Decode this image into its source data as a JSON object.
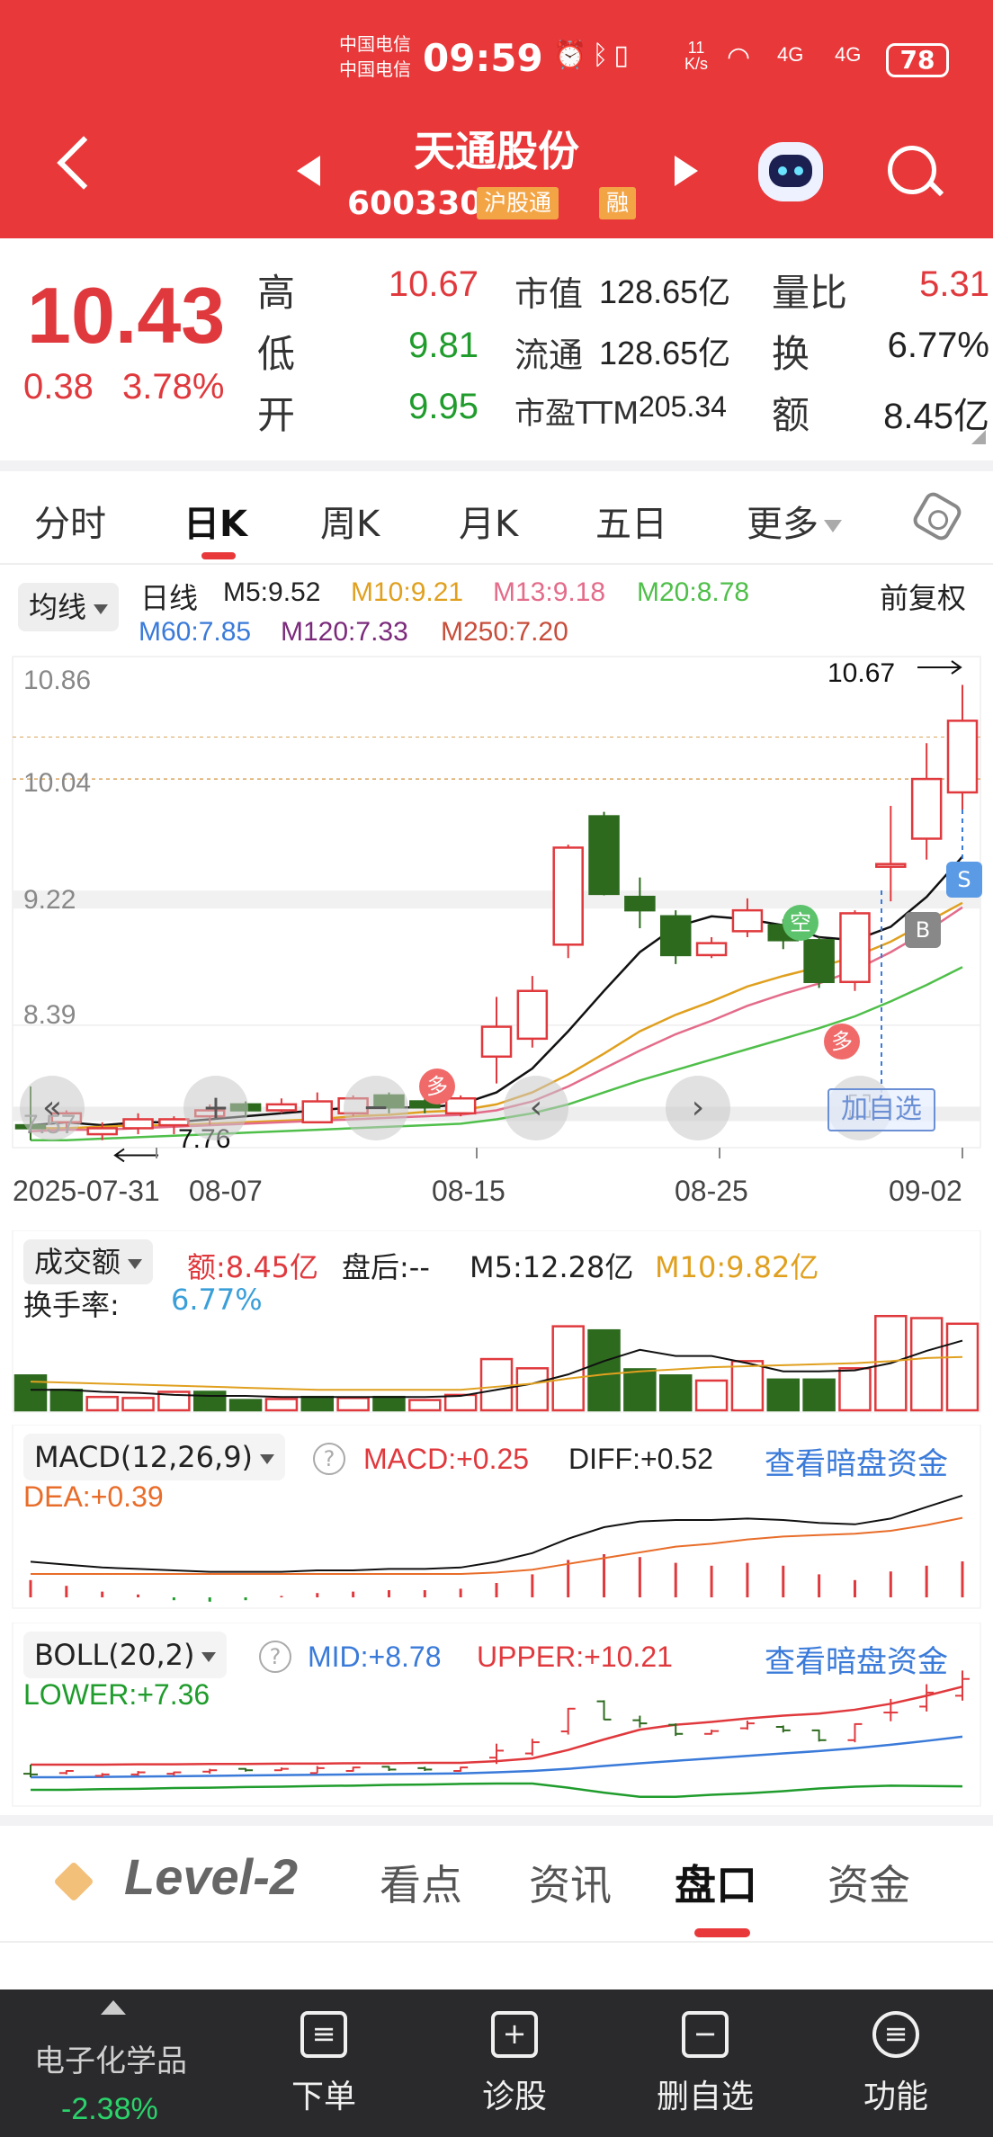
{
  "status_bar": {
    "carrier_1": "中国电信",
    "carrier_2": "中国电信",
    "time": "09:59",
    "net_speed": "11 K/s",
    "network": "4G",
    "battery": "78"
  },
  "header": {
    "stock_name": "天通股份",
    "stock_code": "600330",
    "tag_connect": "沪股通",
    "tag_margin": "融",
    "icons": [
      "back-icon",
      "prev-stock-icon",
      "next-stock-icon",
      "robot-assistant-icon",
      "search-icon"
    ]
  },
  "quote": {
    "price": "10.43",
    "change": "0.38",
    "change_pct": "3.78%",
    "high_label": "高",
    "high": "10.67",
    "low_label": "低",
    "low": "9.81",
    "open_label": "开",
    "open": "9.95",
    "mktcap_label": "市值",
    "mktcap": "128.65亿",
    "float_label": "流通",
    "float": "128.65亿",
    "pe_label": "市盈TTM",
    "pe": "205.34",
    "volratio_label": "量比",
    "volratio": "5.31",
    "turnover_label": "换",
    "turnover": "6.77%",
    "amount_label": "额",
    "amount": "8.45亿"
  },
  "tabs": [
    "分时",
    "日K",
    "周K",
    "月K",
    "五日",
    "更多"
  ],
  "active_tab": "日K",
  "kline_legend": {
    "selector": "均线",
    "period": "日线",
    "adjust": "前复权",
    "ma": [
      {
        "text": "M5:9.52",
        "color": "#222222"
      },
      {
        "text": "M10:9.21",
        "color": "#e0a01f"
      },
      {
        "text": "M13:9.18",
        "color": "#e36c8a"
      },
      {
        "text": "M20:8.78",
        "color": "#4fbf4a"
      },
      {
        "text": "M60:7.85",
        "color": "#3a7ad9"
      },
      {
        "text": "M120:7.33",
        "color": "#7b2a7b"
      },
      {
        "text": "M250:7.20",
        "color": "#c84d3a"
      }
    ]
  },
  "colors": {
    "up": "#e0393d",
    "down": "#2d6a1e",
    "header_bg": "#e8383a",
    "link": "#3a7ad9"
  },
  "kline_axis": {
    "y_ticks": [
      "10.86",
      "10.04",
      "9.22",
      "8.39",
      "7.57"
    ],
    "high_marker": "10.67",
    "low_marker": "7.76",
    "dates": [
      "2025-07-31",
      "08-07",
      "08-15",
      "08-25",
      "09-02"
    ],
    "signals": {
      "sell": "S",
      "buy": "B",
      "short": "空",
      "long": "多",
      "long2": "多"
    },
    "add_favorite": "加自选"
  },
  "volume_panel": {
    "selector": "成交额",
    "amount": "额:8.45亿",
    "after_hours": "盘后:-- ",
    "m5": "M5:12.28亿",
    "m10": "M10:9.82亿",
    "turnover_label": "换手率:",
    "turnover": "6.77%"
  },
  "macd_panel": {
    "selector": "MACD(12,26,9)",
    "macd": "MACD:+0.25",
    "diff": "DIFF:+0.52",
    "dea": "DEA:+0.39",
    "link": "查看暗盘资金"
  },
  "boll_panel": {
    "selector": "BOLL(20,2)",
    "mid": "MID:+8.78",
    "upper": "UPPER:+10.21",
    "lower": "LOWER:+7.36",
    "link": "查看暗盘资金"
  },
  "bottom_tabs": [
    "Level-2",
    "看点",
    "资讯",
    "盘口",
    "资金"
  ],
  "active_bottom_tab": "盘口",
  "bottom_bar": {
    "sector_name": "电子化学品",
    "sector_change": "-2.38%",
    "actions": [
      {
        "label": "下单",
        "icon": "order-icon"
      },
      {
        "label": "诊股",
        "icon": "diagnose-icon"
      },
      {
        "label": "删自选",
        "icon": "remove-favorite-icon"
      },
      {
        "label": "功能",
        "icon": "menu-icon"
      }
    ]
  },
  "chart_data": {
    "type": "candlestick",
    "title": "",
    "x_range": [
      "2025-07-31",
      "2025-09-02"
    ],
    "x_ticks": [
      "2025-07-31",
      "08-07",
      "08-15",
      "08-25",
      "09-02"
    ],
    "ylim": [
      7.57,
      10.86
    ],
    "y_ticks": [
      10.86,
      10.04,
      9.22,
      8.39,
      7.57
    ],
    "candles": [
      {
        "o": 7.72,
        "c": 7.7,
        "h": 7.98,
        "l": 7.62
      },
      {
        "o": 7.74,
        "c": 7.8,
        "h": 7.82,
        "l": 7.7
      },
      {
        "o": 7.66,
        "c": 7.7,
        "h": 7.74,
        "l": 7.62
      },
      {
        "o": 7.7,
        "c": 7.76,
        "h": 7.8,
        "l": 7.66
      },
      {
        "o": 7.72,
        "c": 7.76,
        "h": 7.78,
        "l": 7.66
      },
      {
        "o": 7.78,
        "c": 7.82,
        "h": 7.86,
        "l": 7.72
      },
      {
        "o": 7.86,
        "c": 7.82,
        "h": 7.88,
        "l": 7.78
      },
      {
        "o": 7.82,
        "c": 7.86,
        "h": 7.9,
        "l": 7.8
      },
      {
        "o": 7.74,
        "c": 7.88,
        "h": 7.94,
        "l": 7.74
      },
      {
        "o": 7.8,
        "c": 7.9,
        "h": 7.92,
        "l": 7.78
      },
      {
        "o": 7.92,
        "c": 7.84,
        "h": 7.94,
        "l": 7.8
      },
      {
        "o": 7.88,
        "c": 7.84,
        "h": 7.92,
        "l": 7.8
      },
      {
        "o": 7.8,
        "c": 7.9,
        "h": 7.92,
        "l": 7.78
      },
      {
        "o": 8.18,
        "c": 8.38,
        "h": 8.58,
        "l": 8.0
      },
      {
        "o": 8.3,
        "c": 8.62,
        "h": 8.72,
        "l": 8.24
      },
      {
        "o": 8.93,
        "c": 9.58,
        "h": 9.6,
        "l": 8.84
      },
      {
        "o": 9.79,
        "c": 9.27,
        "h": 9.82,
        "l": 9.26
      },
      {
        "o": 9.25,
        "c": 9.16,
        "h": 9.38,
        "l": 9.04
      },
      {
        "o": 9.12,
        "c": 8.86,
        "h": 9.16,
        "l": 8.8
      },
      {
        "o": 8.86,
        "c": 8.94,
        "h": 8.98,
        "l": 8.84
      },
      {
        "o": 9.02,
        "c": 9.16,
        "h": 9.24,
        "l": 8.98
      },
      {
        "o": 9.06,
        "c": 8.96,
        "h": 9.1,
        "l": 8.9
      },
      {
        "o": 8.96,
        "c": 8.68,
        "h": 8.98,
        "l": 8.64
      },
      {
        "o": 8.68,
        "c": 9.14,
        "h": 9.16,
        "l": 8.62
      },
      {
        "o": 9.47,
        "c": 9.47,
        "h": 9.86,
        "l": 9.22
      },
      {
        "o": 9.64,
        "c": 10.04,
        "h": 10.28,
        "l": 9.5
      },
      {
        "o": 9.95,
        "c": 10.43,
        "h": 10.67,
        "l": 9.81
      }
    ],
    "ma_lines": [
      {
        "name": "M5",
        "values": [
          7.72,
          7.74,
          7.72,
          7.74,
          7.74,
          7.76,
          7.78,
          7.8,
          7.82,
          7.84,
          7.84,
          7.84,
          7.86,
          7.94,
          8.1,
          8.35,
          8.62,
          8.88,
          9.05,
          9.12,
          9.1,
          9.06,
          8.98,
          8.96,
          9.05,
          9.25,
          9.52
        ]
      },
      {
        "name": "M10",
        "values": [
          7.7,
          7.7,
          7.71,
          7.72,
          7.72,
          7.73,
          7.74,
          7.75,
          7.76,
          7.78,
          7.79,
          7.81,
          7.82,
          7.86,
          7.94,
          8.06,
          8.2,
          8.35,
          8.46,
          8.55,
          8.65,
          8.72,
          8.78,
          8.85,
          8.95,
          9.08,
          9.21
        ]
      },
      {
        "name": "M13",
        "values": [
          7.68,
          7.69,
          7.69,
          7.7,
          7.71,
          7.72,
          7.73,
          7.74,
          7.75,
          7.76,
          7.77,
          7.78,
          7.79,
          7.82,
          7.88,
          7.98,
          8.1,
          8.22,
          8.33,
          8.42,
          8.52,
          8.6,
          8.67,
          8.76,
          8.88,
          9.02,
          9.18
        ]
      },
      {
        "name": "M20",
        "values": [
          7.62,
          7.62,
          7.63,
          7.64,
          7.65,
          7.66,
          7.67,
          7.68,
          7.69,
          7.7,
          7.71,
          7.72,
          7.73,
          7.76,
          7.8,
          7.86,
          7.94,
          8.02,
          8.09,
          8.16,
          8.23,
          8.3,
          8.37,
          8.45,
          8.55,
          8.66,
          8.78
        ]
      }
    ],
    "volume": {
      "values": [
        3.4,
        2.0,
        1.3,
        1.2,
        1.8,
        1.8,
        1.0,
        1.1,
        1.3,
        1.2,
        1.3,
        1.0,
        1.5,
        5.0,
        4.1,
        8.2,
        7.8,
        4.0,
        3.4,
        2.9,
        4.8,
        3.0,
        3.0,
        4.1,
        9.2,
        9.0,
        8.45
      ],
      "up": [
        false,
        false,
        true,
        true,
        true,
        false,
        false,
        true,
        false,
        true,
        false,
        true,
        true,
        true,
        true,
        true,
        false,
        false,
        false,
        true,
        true,
        false,
        false,
        true,
        true,
        true,
        true
      ],
      "m5": [
        2.0,
        2.0,
        1.8,
        1.7,
        1.5,
        1.4,
        1.4,
        1.3,
        1.3,
        1.3,
        1.3,
        1.3,
        1.4,
        2.0,
        2.6,
        3.5,
        4.8,
        5.9,
        5.3,
        5.3,
        4.6,
        3.8,
        3.8,
        3.9,
        4.6,
        5.8,
        6.8
      ],
      "m10": [
        2.8,
        2.7,
        2.6,
        2.5,
        2.4,
        2.3,
        2.2,
        2.1,
        2.0,
        2.0,
        2.0,
        2.0,
        2.0,
        2.3,
        2.6,
        3.1,
        3.5,
        3.8,
        4.0,
        4.2,
        4.3,
        4.4,
        4.5,
        4.6,
        4.8,
        5.1,
        5.2
      ]
    },
    "macd": {
      "bars": [
        0.12,
        0.08,
        0.04,
        0.02,
        -0.02,
        -0.03,
        -0.02,
        0.01,
        0.03,
        0.04,
        0.05,
        0.05,
        0.06,
        0.1,
        0.16,
        0.26,
        0.3,
        0.28,
        0.24,
        0.22,
        0.24,
        0.22,
        0.16,
        0.12,
        0.18,
        0.22,
        0.25
      ],
      "diff": [
        0.06,
        0.04,
        0.02,
        0.01,
        0.0,
        -0.01,
        -0.01,
        -0.01,
        0.0,
        0.0,
        0.01,
        0.01,
        0.02,
        0.06,
        0.12,
        0.22,
        0.3,
        0.34,
        0.35,
        0.35,
        0.36,
        0.35,
        0.33,
        0.32,
        0.36,
        0.44,
        0.52
      ],
      "dea": [
        0.0,
        0.0,
        0.0,
        0.0,
        0.0,
        0.0,
        0.0,
        0.0,
        0.0,
        0.0,
        0.0,
        0.0,
        0.0,
        0.01,
        0.03,
        0.07,
        0.11,
        0.15,
        0.19,
        0.21,
        0.24,
        0.26,
        0.27,
        0.28,
        0.3,
        0.34,
        0.39
      ]
    },
    "boll": {
      "upper": [
        7.98,
        7.98,
        7.98,
        7.99,
        7.99,
        8.0,
        8.0,
        8.01,
        8.01,
        8.02,
        8.02,
        8.03,
        8.03,
        8.08,
        8.16,
        8.4,
        8.7,
        8.98,
        9.12,
        9.2,
        9.3,
        9.38,
        9.44,
        9.55,
        9.72,
        9.95,
        10.21
      ],
      "mid": [
        7.62,
        7.62,
        7.63,
        7.64,
        7.65,
        7.66,
        7.67,
        7.68,
        7.69,
        7.7,
        7.71,
        7.72,
        7.73,
        7.76,
        7.8,
        7.86,
        7.94,
        8.02,
        8.09,
        8.16,
        8.23,
        8.3,
        8.37,
        8.45,
        8.55,
        8.66,
        8.78
      ],
      "lower": [
        7.26,
        7.26,
        7.28,
        7.29,
        7.31,
        7.32,
        7.34,
        7.35,
        7.37,
        7.38,
        7.4,
        7.41,
        7.43,
        7.44,
        7.44,
        7.32,
        7.18,
        7.06,
        7.06,
        7.12,
        7.16,
        7.22,
        7.3,
        7.35,
        7.38,
        7.37,
        7.36
      ]
    }
  }
}
